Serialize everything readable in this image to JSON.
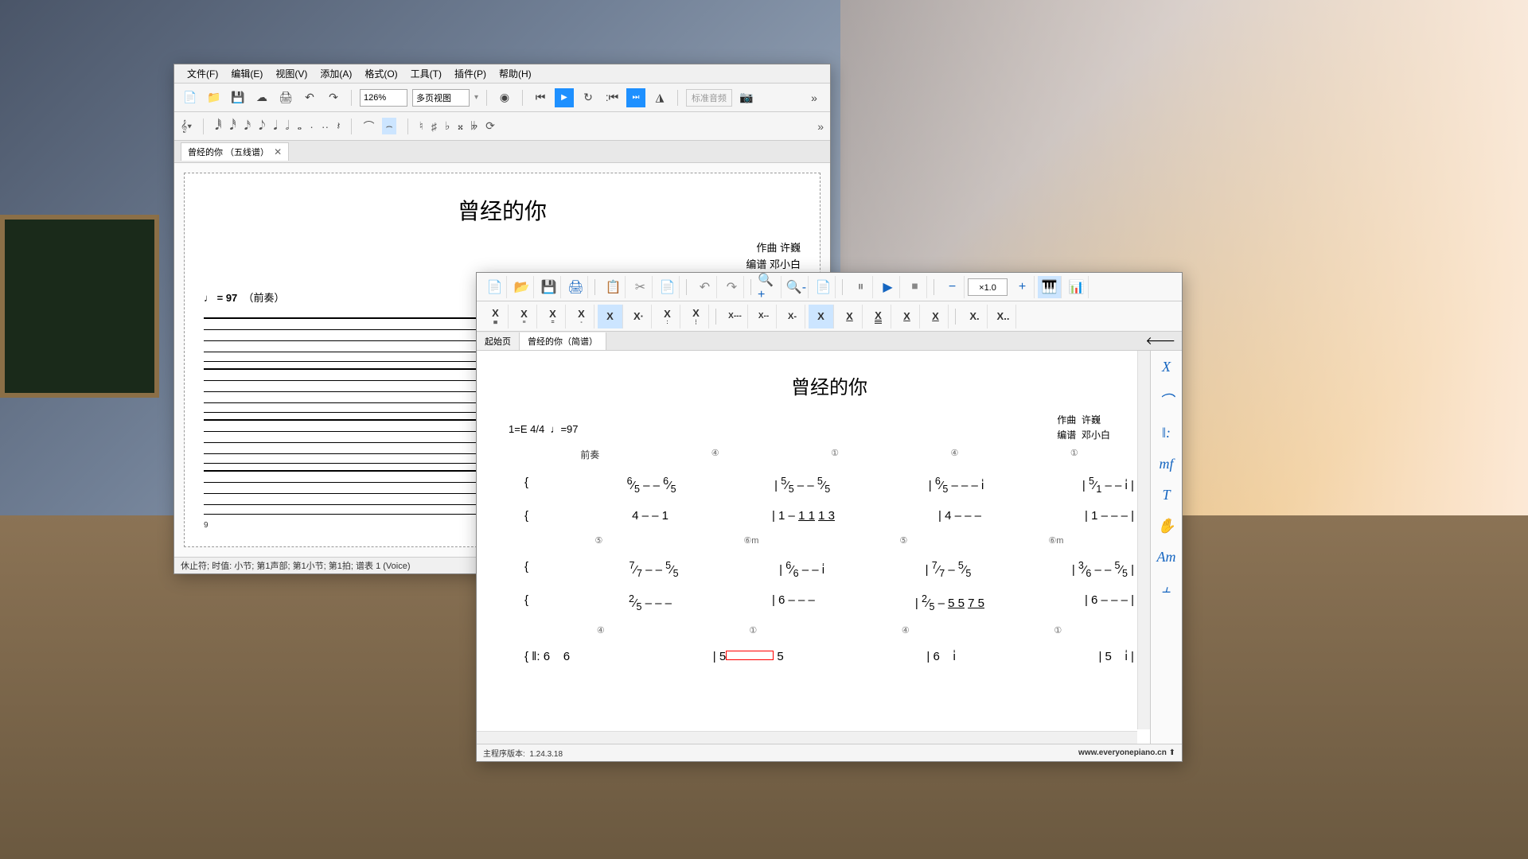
{
  "win1": {
    "menu": [
      "文件(F)",
      "编辑(E)",
      "视图(V)",
      "添加(A)",
      "格式(O)",
      "工具(T)",
      "插件(P)",
      "帮助(H)"
    ],
    "zoom": "126%",
    "view_mode": "多页视图",
    "audio_label": "标准音频",
    "tab_title": "曾经的你 （五线谱）",
    "score": {
      "title": "曾经的你",
      "composer_label": "作曲",
      "composer": "许巍",
      "arranger_label": "编谱",
      "arranger": "邓小白",
      "tempo": "= 97",
      "tempo_note": "（前奏）",
      "measure_num": "9"
    },
    "status": "休止符; 时值: 小节; 第1声部; 第1小节; 第1拍; 谱表 1 (Voice)"
  },
  "win2": {
    "speed": "×1.0",
    "tabs": [
      "起始页",
      "曾经的你（简谱）"
    ],
    "score": {
      "title": "曾经的你",
      "key": "1=E",
      "time_sig": "4/4",
      "tempo_mark": "♩=97",
      "composer_label": "作曲",
      "composer": "许巍",
      "arranger_label": "编谱",
      "arranger": "邓小白",
      "section_label": "前奏",
      "chords_row1": [
        "④",
        "①",
        "④",
        "①"
      ],
      "chords_row2": [
        "⑤",
        "⑥m",
        "⑤",
        "⑥m"
      ],
      "chords_row3": [
        "④",
        "①",
        "④",
        "①"
      ]
    },
    "sidebar": [
      "X",
      "⌒",
      "‖:",
      "mf",
      "T",
      "✋",
      "Am",
      "⫠"
    ],
    "footer_version_label": "主程序版本:",
    "footer_version": "1.24.3.18",
    "footer_url": "www.everyonepiano.cn"
  }
}
